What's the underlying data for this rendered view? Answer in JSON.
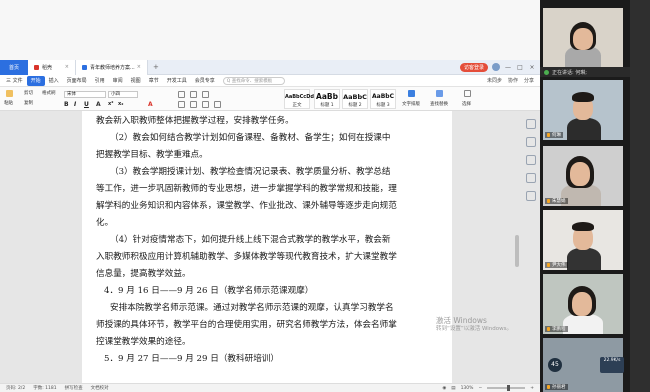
{
  "tabbar": {
    "home": "首页",
    "doc1": "稻壳",
    "doc2": "青年教师培养方案...",
    "login": "访客登录",
    "controls": [
      "—",
      "□",
      "×"
    ]
  },
  "menubar": {
    "file": "三 文件",
    "items": [
      "开始",
      "插入",
      "页面布局",
      "引用",
      "审阅",
      "视图",
      "章节",
      "开发工具",
      "会员专享"
    ],
    "active": "开始",
    "search": "Q 查找命令、搜索模板",
    "right": [
      "未同步",
      "协作",
      "分享"
    ]
  },
  "ribbon": {
    "paste": "粘贴",
    "cut": "剪切",
    "copy": "复制",
    "painter": "格式刷",
    "font": "宋体",
    "size": "小四",
    "format": [
      "B",
      "I",
      "U",
      "A",
      "x²",
      "x₂",
      "A"
    ],
    "styles": [
      {
        "preview": "AaBbCcDd",
        "name": "正文"
      },
      {
        "preview": "AaBb",
        "name": "标题 1"
      },
      {
        "preview": "AaBbC",
        "name": "标题 2"
      },
      {
        "preview": "AaBbC",
        "name": "标题 3"
      }
    ],
    "tools": [
      "文字排版",
      "查找替换",
      "选择"
    ]
  },
  "document": {
    "lines": [
      "教会新入职教师整体把握教学过程，安排教学任务。",
      "（2）教会如何结合教学计划如何备课程、备教材、备学生；如何在授课中",
      "把握教学目标、教学重难点。",
      "（3）教会学期授课计划、教学检查情况记录表、教学质量分析、教学总结",
      "等工作，进一步巩固新教师的专业思想，进一步掌握学科的教学常规和技能，理",
      "解学科的业务知识和内容体系，课堂教学、作业批改、课外辅导等逐步走向规范",
      "化。",
      "（4）针对疫情常态下，如何提升线上线下混合式教学的教学水平，教会新",
      "入职教师积极应用计算机辅助教学、多媒体教学等现代教育技术，扩大课堂教学",
      "信息量，提高教学效益。",
      "4．9 月 16 日——9 月 26 日（教学名师示范课观摩）",
      "安排本院教学名师示范课。通过对教学名师示范课的观摩，认真学习教学名",
      "师授课的具体环节，教学平台的合理使用实用，研究名师教学方法，体会名师掌",
      "控课堂教学效果的途径。",
      "5．9 月 27 日——9 月 29 日（教科研培训）"
    ]
  },
  "watermark": {
    "title": "激活 Windows",
    "subtitle": "转到“设置”以激活 Windows。"
  },
  "statusbar": {
    "page": "页码: 2/2",
    "words": "字数: 1181",
    "spell": "拼写检查",
    "proof": "文档校对",
    "zoom": "130%"
  },
  "video": {
    "speaker": "正在讲话: 何琳;",
    "participants": [
      "",
      "何琳",
      "",
      "朱慧娟",
      "尹大伟",
      "",
      "李鹏程",
      "孙丽君"
    ],
    "timer": "45",
    "network": "22.9K/s"
  },
  "colors": {
    "accent": "#2c6fe0",
    "login": "#e44d3a"
  }
}
